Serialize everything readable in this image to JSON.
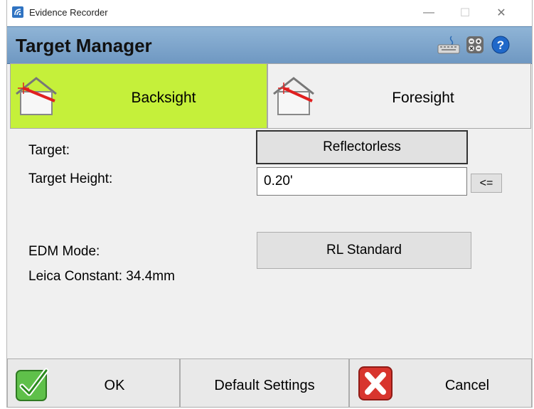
{
  "window": {
    "title": "Evidence Recorder",
    "minimize_glyph": "—",
    "maximize_glyph": "☐",
    "close_glyph": "✕"
  },
  "header": {
    "title": "Target Manager",
    "icons": [
      "keyboard-icon",
      "calculator-icon",
      "help-icon"
    ],
    "help_glyph": "?"
  },
  "tabs": [
    {
      "label": "Backsight",
      "active": true,
      "icon": "house-target-icon"
    },
    {
      "label": "Foresight",
      "active": false,
      "icon": "house-target-icon"
    }
  ],
  "form": {
    "target_label": "Target:",
    "target_value": "Reflectorless",
    "height_label": "Target Height:",
    "height_value": "0.20'",
    "height_button": "<=",
    "edm_label": "EDM Mode:",
    "edm_value": "RL Standard",
    "constant_text": "Leica Constant: 34.4mm"
  },
  "footer": {
    "ok_label": "OK",
    "defaults_label": "Default Settings",
    "cancel_label": "Cancel"
  },
  "colors": {
    "active_tab": "#c5f03a",
    "header": "#7fa6cd",
    "ok_icon": "#4caf3b",
    "cancel_icon": "#d7352f"
  }
}
